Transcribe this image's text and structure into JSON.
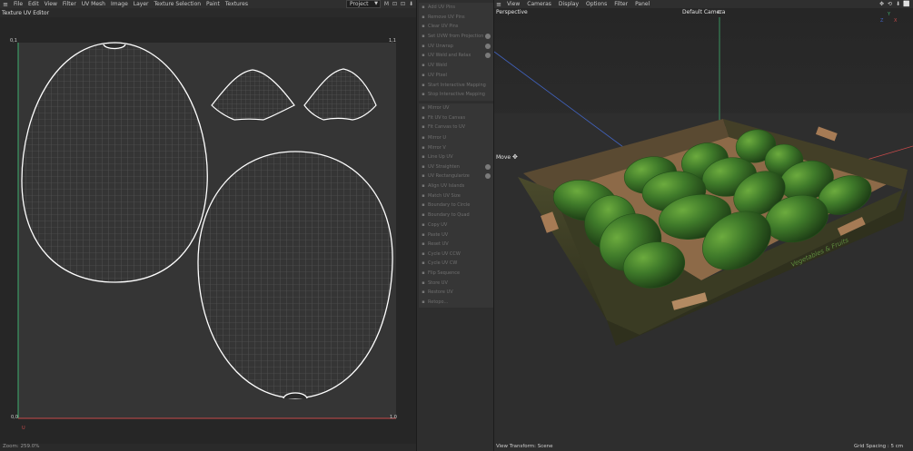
{
  "uv_editor": {
    "menu": [
      "File",
      "Edit",
      "View",
      "Filter",
      "UV Mesh",
      "Image",
      "Layer",
      "Texture Selection",
      "Paint",
      "Textures"
    ],
    "title": "Texture UV Editor",
    "project_select": "Project",
    "corner_labels": {
      "top_left": "0,1",
      "top_right": "1,1",
      "bottom_left": "0,0",
      "bottom_right": "1,0"
    },
    "axis_labels": {
      "u": "U",
      "v": "V"
    },
    "zoom": "Zoom: 259.0%",
    "toolbar_icons": [
      "magnet-icon",
      "lock-icon",
      "lock-icon",
      "move-down-icon"
    ]
  },
  "tools_panel": {
    "groups": [
      {
        "items": [
          {
            "label": "Add UV Pins",
            "icon": "pin-icon"
          },
          {
            "label": "Remove UV Pins",
            "icon": "pin-remove-icon"
          },
          {
            "label": "Clear UV Pins",
            "icon": "pin-clear-icon"
          }
        ]
      },
      {
        "items": [
          {
            "label": "Set UVW from Projection",
            "icon": "projection-icon",
            "gear": true
          },
          {
            "label": "UV Unwrap",
            "icon": "unwrap-icon",
            "gear": true
          },
          {
            "label": "UV Weld and Relax",
            "icon": "weld-icon",
            "gear": true
          },
          {
            "label": "UV Weld",
            "icon": "weld-icon"
          }
        ]
      },
      {
        "items": [
          {
            "label": "UV Ptxel",
            "icon": "pixel-icon"
          },
          {
            "label": "Start Interactive Mapping",
            "icon": "mapping-icon"
          },
          {
            "label": "Stop Interactive Mapping",
            "icon": "mapping-icon"
          }
        ]
      },
      {
        "items": [
          {
            "label": "Mirror UV",
            "icon": "mirror-icon"
          },
          {
            "label": "Fit UV to Canvas",
            "icon": "fit-icon"
          },
          {
            "label": "Fit Canvas to UV",
            "icon": "fit-icon"
          }
        ]
      },
      {
        "items": [
          {
            "label": "Mirror U",
            "icon": "mirror-u-icon"
          },
          {
            "label": "Mirror V",
            "icon": "mirror-v-icon"
          },
          {
            "label": "Line Up UV",
            "icon": "lineup-icon"
          },
          {
            "label": "UV Straighten",
            "icon": "straighten-icon",
            "gear": true
          },
          {
            "label": "UV Rectangularize",
            "icon": "rectangularize-icon",
            "gear": true
          },
          {
            "label": "Align UV Islands",
            "icon": "align-icon"
          },
          {
            "label": "Match UV Size",
            "icon": "match-icon"
          },
          {
            "label": "Boundary to Circle",
            "icon": "circle-icon"
          },
          {
            "label": "Boundary to Quad",
            "icon": "quad-icon"
          }
        ]
      },
      {
        "items": [
          {
            "label": "Copy UV",
            "icon": "copy-icon"
          },
          {
            "label": "Paste UV",
            "icon": "paste-icon"
          },
          {
            "label": "Reset UV",
            "icon": "reset-icon"
          },
          {
            "label": "Cycle UV CCW",
            "icon": "cycle-ccw-icon"
          },
          {
            "label": "Cycle UV CW",
            "icon": "cycle-cw-icon"
          },
          {
            "label": "Flip Sequence",
            "icon": "flip-icon"
          },
          {
            "label": "Store UV",
            "icon": "store-icon"
          },
          {
            "label": "Restore UV",
            "icon": "restore-icon"
          },
          {
            "label": "Retopo...",
            "icon": "retopo-icon"
          }
        ]
      }
    ]
  },
  "viewport": {
    "menu": [
      "View",
      "Cameras",
      "Display",
      "Options",
      "Filter",
      "Panel"
    ],
    "mode": "Perspective",
    "camera": "Default Camera",
    "tool_label": "Move",
    "crate_text": "Vegetables & Fruits",
    "view_transform": "View Transform: Scene",
    "grid_spacing": "Grid Spacing : 5 cm",
    "axis_labels": {
      "x": "X",
      "y": "Y",
      "z": "Z"
    },
    "toolbar_icons": [
      "move-icon",
      "rotate-icon",
      "zoom-icon",
      "maximize-icon"
    ]
  },
  "colors": {
    "avocado": "#3f7a2a",
    "avocado_dark": "#24521a",
    "crate_dark": "#3e3f25",
    "crate_inner": "#8d6a48",
    "label_green": "#5d8b3e",
    "y_axis": "#3fae6d",
    "x_axis": "#c64a4a",
    "z_axis": "#4163c0"
  }
}
